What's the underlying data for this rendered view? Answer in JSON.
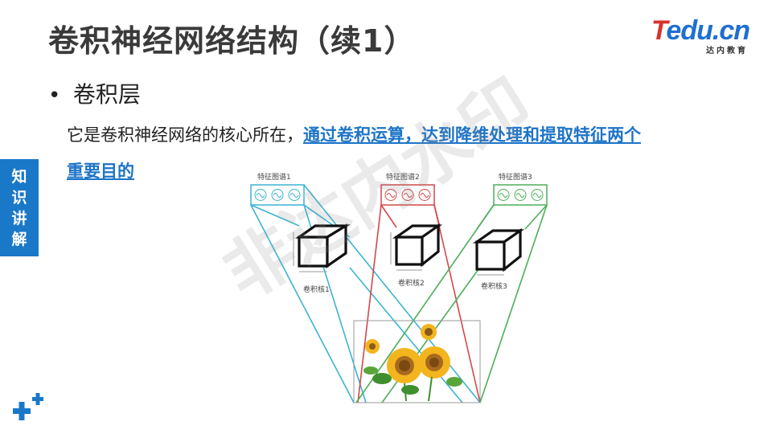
{
  "slide": {
    "title": "卷积神经网络结构（续1）",
    "logo_main": "Tedu.cn",
    "logo_sub": "达内教育",
    "bullet": "•",
    "heading": "卷积层",
    "paragraph_plain": "它是卷积神经网络的核心所在，",
    "paragraph_highlight_1": "通过卷积运算，达到降维处理和提取特征两个",
    "paragraph_highlight_2": "重要目的",
    "side_tab": [
      "知",
      "识",
      "讲",
      "解"
    ],
    "watermark": "非达内水印"
  },
  "figure": {
    "feature_map_labels": [
      "特征图谱1",
      "特征图谱2",
      "特征图谱3"
    ],
    "kernel_labels": [
      "卷积核1",
      "卷积核2",
      "卷积核3"
    ],
    "colors": {
      "map1": "#3bb4d2",
      "map2": "#d2484a",
      "map3": "#4cae5a"
    },
    "image_icon": "sunflower-image"
  }
}
